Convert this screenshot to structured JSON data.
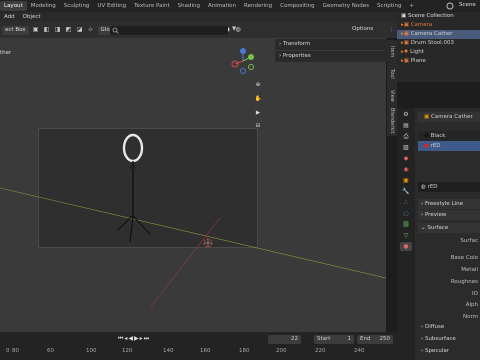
{
  "workspace_tabs": [
    "Layout",
    "Modeling",
    "Sculpting",
    "UV Editing",
    "Texture Paint",
    "Shading",
    "Animation",
    "Rendering",
    "Compositing",
    "Geometry Nodes",
    "Scripting",
    "+"
  ],
  "active_tab": "Layout",
  "scene_name": "Scene",
  "menu": [
    "Add",
    "Object"
  ],
  "viewport_header": {
    "select_mode": "ect Box",
    "transform_orientation": "Global",
    "options_label": "Options"
  },
  "viewport_corner_label": "ther",
  "npanel": {
    "transform_label": "Transform",
    "properties_label": "Properties"
  },
  "side_tabs": [
    "Item",
    "Tool",
    "View",
    "Blenderkit"
  ],
  "outliner": {
    "title": "Scene Collection",
    "items": [
      "Camera",
      "Camera Cather",
      "Drum Stool.003",
      "Light",
      "Plane"
    ]
  },
  "properties": {
    "object_name": "Camera Cather",
    "materials": [
      "Black",
      "rED"
    ],
    "active_material": "rED",
    "sections": [
      "Freestyle Line",
      "Preview",
      "Surface"
    ],
    "fields": [
      "Surfac",
      "Base Colo",
      "Metall",
      "Roughnes",
      "IO",
      "Alph",
      "Norm"
    ],
    "subsections": [
      "Diffuse",
      "Subsurface",
      "Specular"
    ]
  },
  "timeline": {
    "current_frame": "22",
    "start_label": "Start",
    "start_value": "1",
    "end_label": "End",
    "end_value": "250",
    "ticks": [
      "0",
      "60",
      "80",
      "100",
      "120",
      "140",
      "160",
      "180",
      "200",
      "220",
      "240"
    ]
  }
}
